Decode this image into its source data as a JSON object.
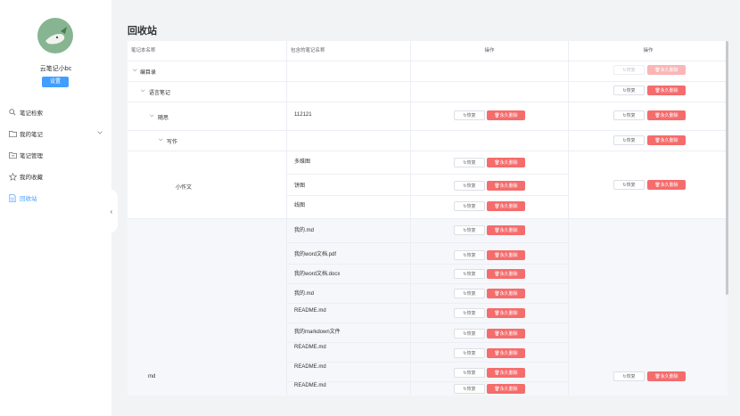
{
  "sidebar": {
    "username": "云笔记小bc",
    "settings_label": "设置",
    "items": [
      {
        "label": "笔记检索",
        "icon": "search-icon"
      },
      {
        "label": "我的笔记",
        "icon": "folder-icon"
      },
      {
        "label": "笔记管理",
        "icon": "folder-manage-icon"
      },
      {
        "label": "我的收藏",
        "icon": "star-icon"
      },
      {
        "label": "回收站",
        "icon": "document-icon"
      }
    ],
    "collapse_symbol": "‹"
  },
  "page": {
    "title": "回收站"
  },
  "table": {
    "headers": [
      "笔记本名称",
      "包含的笔记名称",
      "操作",
      "操作"
    ],
    "restore_label": "恢复",
    "delete_label": "永久删除",
    "rows": [
      {
        "notebook": "编目录",
        "toggle": "⌵",
        "notes": []
      },
      {
        "notebook": "语言笔记",
        "toggle": "⌵",
        "notes": []
      },
      {
        "notebook": "随思",
        "toggle": "⌵",
        "notes": [
          "112121"
        ]
      },
      {
        "notebook": "写作",
        "toggle": "⌵",
        "notes": []
      },
      {
        "notebook": "小作文",
        "notes": [
          "多维图",
          "饼图",
          "线图"
        ]
      },
      {
        "notebook": "md",
        "notes": [
          "我的.md",
          "我的word文档.pdf",
          "我的word文档.docx",
          "我的.md",
          "README.md",
          "我的markdown文件",
          "README.md",
          "README.md",
          "README.md"
        ]
      }
    ]
  }
}
